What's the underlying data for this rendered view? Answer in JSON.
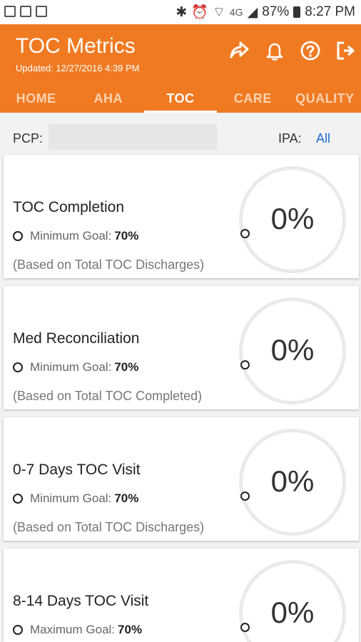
{
  "status_bar": {
    "icons_left": [
      "image-icon",
      "flipboard-icon",
      "app-icon"
    ],
    "lte": "4G",
    "battery": "87%",
    "time": "8:27 PM"
  },
  "header": {
    "title": "TOC Metrics",
    "updated": "Updated: 12/27/2016 4:39 PM",
    "action_icons": [
      "share-icon",
      "bell-icon",
      "help-icon",
      "logout-icon"
    ]
  },
  "tabs": [
    {
      "label": "HOME",
      "active": false
    },
    {
      "label": "AHA",
      "active": false
    },
    {
      "label": "TOC",
      "active": true
    },
    {
      "label": "CARE",
      "active": false
    },
    {
      "label": "QUALITY",
      "active": false
    }
  ],
  "filters": {
    "pcp_label": "PCP:",
    "pcp_value": "",
    "ipa_label": "IPA:",
    "ipa_value": "All"
  },
  "metrics": [
    {
      "name": "TOC Completion",
      "goal_label": "Minimum Goal:",
      "goal_value": "70%",
      "basis": "(Based on Total TOC Discharges)",
      "percent": "0%"
    },
    {
      "name": "Med Reconciliation",
      "goal_label": "Minimum Goal:",
      "goal_value": "70%",
      "basis": "(Based on Total TOC Completed)",
      "percent": "0%"
    },
    {
      "name": "0-7 Days TOC Visit",
      "goal_label": "Minimum Goal:",
      "goal_value": "70%",
      "basis": "(Based on Total TOC Discharges)",
      "percent": "0%"
    },
    {
      "name": "8-14 Days TOC Visit",
      "goal_label": "Maximum Goal:",
      "goal_value": "70%",
      "basis": "",
      "percent": "0%"
    }
  ],
  "colors": {
    "accent": "#f07a22",
    "link": "#1e6fd0"
  }
}
